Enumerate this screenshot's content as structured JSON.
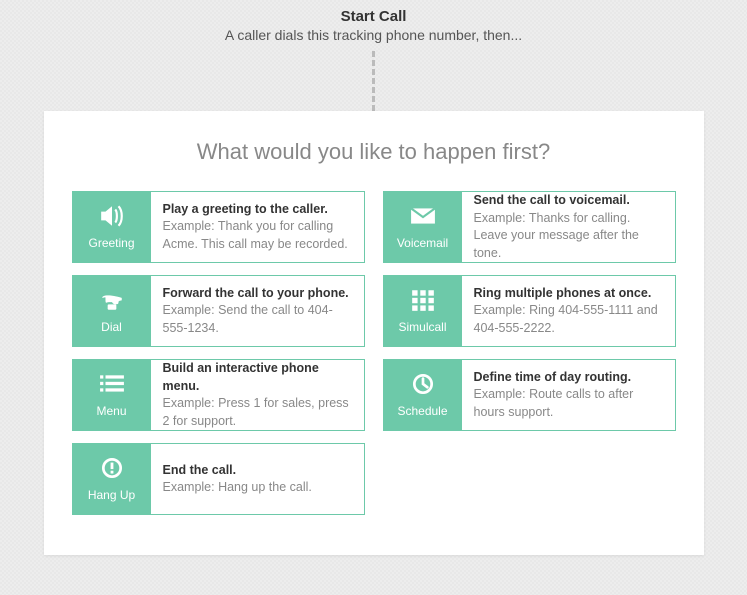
{
  "header": {
    "title": "Start Call",
    "subtitle": "A caller dials this tracking phone number, then..."
  },
  "panel": {
    "title": "What would you like to happen first?"
  },
  "options": [
    {
      "key": "greeting",
      "label": "Greeting",
      "title": "Play a greeting to the caller.",
      "desc": "Example: Thank you for calling Acme. This call may be recorded."
    },
    {
      "key": "voicemail",
      "label": "Voicemail",
      "title": "Send the call to voicemail.",
      "desc": "Example: Thanks for calling. Leave your message after the tone."
    },
    {
      "key": "dial",
      "label": "Dial",
      "title": "Forward the call to your phone.",
      "desc": "Example: Send the call to 404-555-1234."
    },
    {
      "key": "simulcall",
      "label": "Simulcall",
      "title": "Ring multiple phones at once.",
      "desc": "Example: Ring 404-555-1111 and 404-555-2222."
    },
    {
      "key": "menu",
      "label": "Menu",
      "title": "Build an interactive phone menu.",
      "desc": "Example: Press 1 for sales, press 2 for support."
    },
    {
      "key": "schedule",
      "label": "Schedule",
      "title": "Define time of day routing.",
      "desc": "Example: Route calls to after hours support."
    },
    {
      "key": "hangup",
      "label": "Hang Up",
      "title": "End the call.",
      "desc": "Example: Hang up the call."
    }
  ]
}
